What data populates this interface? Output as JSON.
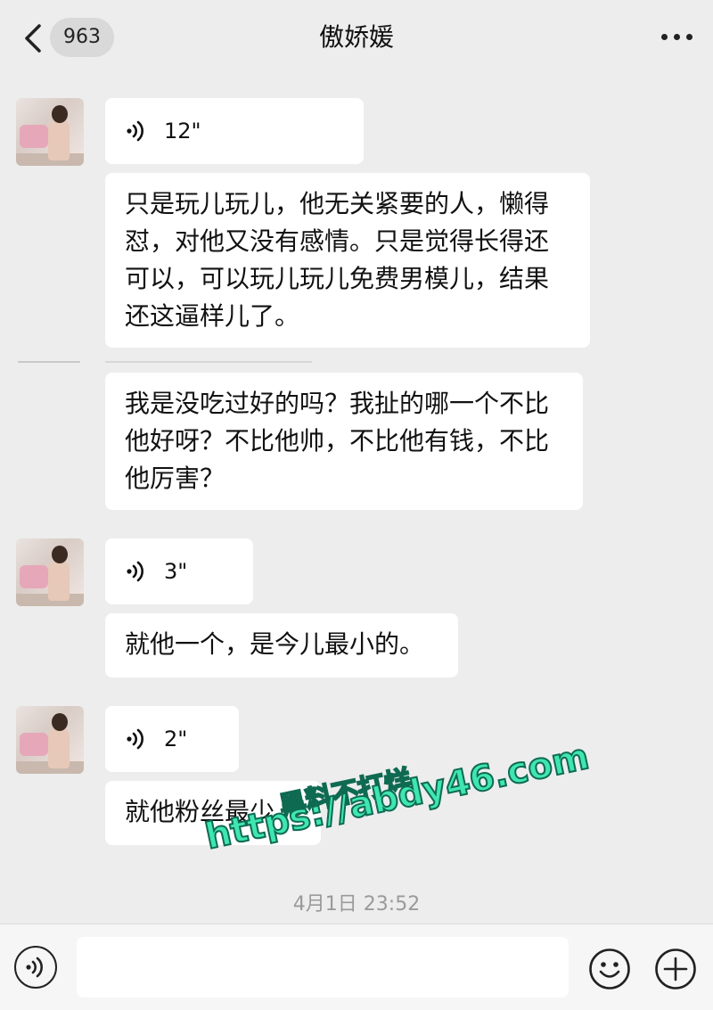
{
  "header": {
    "back_icon": "chevron-left-icon",
    "unread_badge": "963",
    "title": "傲娇媛",
    "more_icon": "more-dots-icon"
  },
  "messages": [
    {
      "type": "voice",
      "duration": "12\""
    },
    {
      "type": "text",
      "text": "只是玩儿玩儿，他无关紧要的人，懒得怼，对他又没有感情。只是觉得长得还可以，可以玩儿玩儿免费男模儿，结果还这逼样儿了。"
    },
    {
      "type": "text",
      "text": "我是没吃过好的吗？我扯的哪一个不比他好呀？不比他帅，不比他有钱，不比他厉害？"
    },
    {
      "type": "voice",
      "duration": "3\""
    },
    {
      "type": "text",
      "text": "就他一个，是今儿最小的。"
    },
    {
      "type": "voice",
      "duration": "2\""
    },
    {
      "type": "text",
      "text": "就他粉丝最少"
    }
  ],
  "timestamp": "4月1日 23:52",
  "watermark": {
    "line1": "黑料不打烊",
    "line2": "https://abdy46.com"
  },
  "input_bar": {
    "voice_icon": "voice-mode-icon",
    "emoji_icon": "emoji-icon",
    "plus_icon": "plus-icon"
  },
  "colors": {
    "background": "#ededed",
    "bubble": "#ffffff",
    "watermark": "#3fe6b0"
  }
}
